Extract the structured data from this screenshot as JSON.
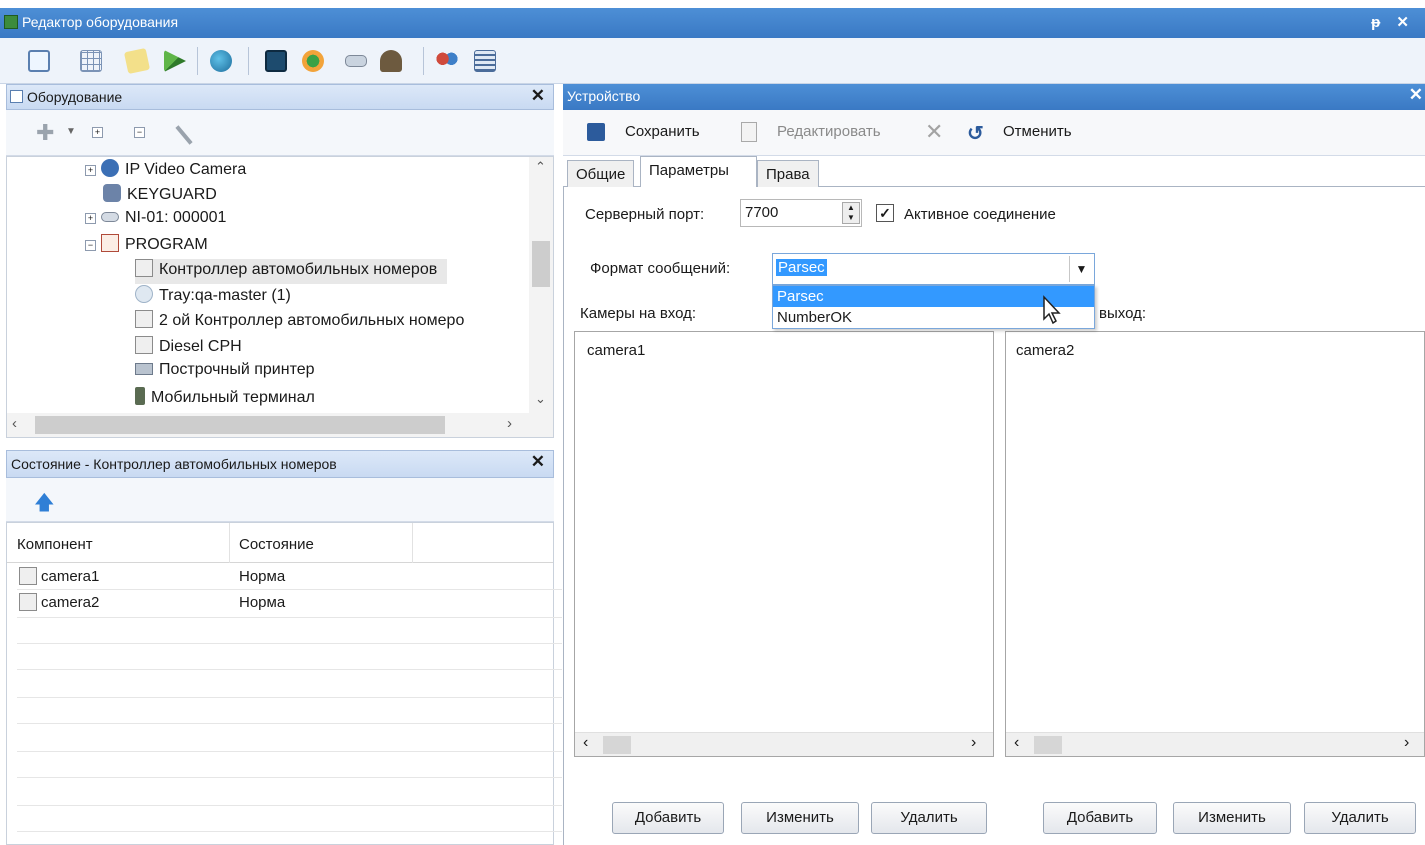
{
  "window": {
    "title": "Редактор оборудования",
    "controls": "ᵽ ✕"
  },
  "equipment_panel": {
    "title": "Оборудование",
    "tree": [
      {
        "label": "IP Video Camera",
        "icon": "camera-icon",
        "expander": "+"
      },
      {
        "label": "KEYGUARD",
        "icon": "keyguard-icon",
        "expander": ""
      },
      {
        "label": "NI-01: 000001",
        "icon": "network-device-icon",
        "expander": "+"
      },
      {
        "label": "PROGRAM",
        "icon": "program-icon",
        "expander": "−"
      },
      {
        "label": "Контроллер автомобильных номеров",
        "icon": "controller-icon",
        "expander": ""
      },
      {
        "label": "Tray:qa-master (1)",
        "icon": "tray-icon",
        "expander": ""
      },
      {
        "label": "2 ой Контроллер автомобильных номеро",
        "icon": "controller-icon",
        "expander": ""
      },
      {
        "label": "Diesel CPH",
        "icon": "controller-icon",
        "expander": ""
      },
      {
        "label": "Построчный принтер",
        "icon": "printer-icon",
        "expander": ""
      },
      {
        "label": "Мобильный терминал",
        "icon": "mobile-terminal-icon",
        "expander": ""
      }
    ]
  },
  "state_panel": {
    "title": "Состояние - Контроллер автомобильных номеров",
    "columns": [
      "Компонент",
      "Состояние"
    ],
    "rows": [
      {
        "component": "camera1",
        "state": "Норма"
      },
      {
        "component": "camera2",
        "state": "Норма"
      }
    ]
  },
  "device_panel": {
    "title": "Устройство",
    "toolbar": {
      "save": "Сохранить",
      "edit": "Редактировать",
      "cancel": "Отменить"
    },
    "tabs": [
      "Общие",
      "Параметры",
      "Права"
    ],
    "server_port_label": "Серверный порт:",
    "server_port_value": "7700",
    "active_connection_label": "Активное соединение",
    "active_connection_checked": true,
    "format_label": "Формат сообщений:",
    "format_value": "Parsec",
    "format_options": [
      "Parsec",
      "NumberOK"
    ],
    "cameras_in_label": "Камеры на вход:",
    "cameras_out_label_visible": "выход:",
    "cameras_in": [
      "camera1"
    ],
    "cameras_out": [
      "camera2"
    ],
    "buttons": {
      "add": "Добавить",
      "change": "Изменить",
      "delete": "Удалить"
    }
  },
  "colors": {
    "titlebar": "#3a79c4",
    "selection": "#3399ff",
    "panel_header": "#c9daf2"
  }
}
